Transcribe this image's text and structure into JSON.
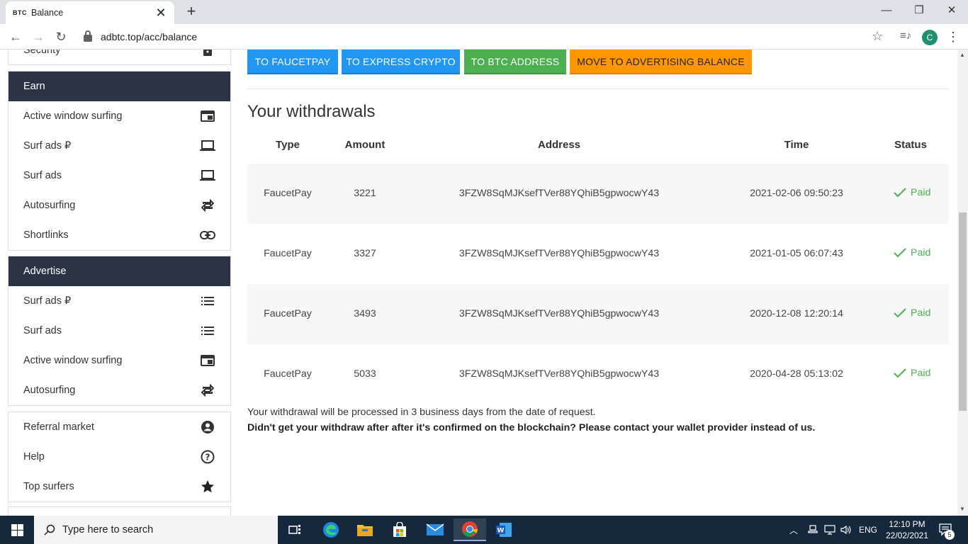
{
  "browser": {
    "tab_favicon": "BTC",
    "tab_title": "Balance",
    "url": "adbtc.top/acc/balance",
    "profile_initial": "C"
  },
  "sidebar": {
    "top_item": "Security",
    "earn": {
      "header": "Earn",
      "items": [
        {
          "label": "Active window surfing",
          "icon": "window-icon"
        },
        {
          "label": "Surf ads ₽",
          "icon": "laptop-icon"
        },
        {
          "label": "Surf ads",
          "icon": "laptop-icon"
        },
        {
          "label": "Autosurfing",
          "icon": "repeat-icon"
        },
        {
          "label": "Shortlinks",
          "icon": "link-icon"
        }
      ]
    },
    "advertise": {
      "header": "Advertise",
      "items": [
        {
          "label": "Surf ads ₽",
          "icon": "list-icon"
        },
        {
          "label": "Surf ads",
          "icon": "list-icon"
        },
        {
          "label": "Active window surfing",
          "icon": "window-icon"
        },
        {
          "label": "Autosurfing",
          "icon": "repeat-icon"
        }
      ]
    },
    "misc": {
      "items": [
        {
          "label": "Referral market",
          "icon": "account-circle-icon"
        },
        {
          "label": "Help",
          "icon": "help-circle-icon"
        },
        {
          "label": "Top surfers",
          "icon": "star-icon"
        }
      ]
    }
  },
  "actions": {
    "faucetpay": "TO FAUCETPAY",
    "express_crypto": "TO EXPRESS CRYPTO",
    "btc_address": "TO BTC ADDRESS",
    "advertising": "MOVE TO ADVERTISING BALANCE",
    "colors": {
      "blue": "#2196f3",
      "green": "#4caf50",
      "orange": "#ff9800"
    }
  },
  "withdrawals": {
    "title": "Your withdrawals",
    "columns": [
      "Type",
      "Amount",
      "Address",
      "Time",
      "Status"
    ],
    "rows": [
      {
        "type": "FaucetPay",
        "amount": "3221",
        "address": "3FZW8SqMJKsefTVer88YQhiB5gpwocwY43",
        "time": "2021-02-06 09:50:23",
        "status": "Paid"
      },
      {
        "type": "FaucetPay",
        "amount": "3327",
        "address": "3FZW8SqMJKsefTVer88YQhiB5gpwocwY43",
        "time": "2021-01-05 06:07:43",
        "status": "Paid"
      },
      {
        "type": "FaucetPay",
        "amount": "3493",
        "address": "3FZW8SqMJKsefTVer88YQhiB5gpwocwY43",
        "time": "2020-12-08 12:20:14",
        "status": "Paid"
      },
      {
        "type": "FaucetPay",
        "amount": "5033",
        "address": "3FZW8SqMJKsefTVer88YQhiB5gpwocwY43",
        "time": "2020-04-28 05:13:02",
        "status": "Paid"
      }
    ],
    "note": "Your withdrawal will be processed in 3 business days from the date of request.",
    "note_bold": "Didn't get your withdraw after after it's confirmed on the blockchain? Please contact your wallet provider instead of us."
  },
  "taskbar": {
    "search_placeholder": "Type here to search",
    "language": "ENG",
    "time": "12:10 PM",
    "date": "22/02/2021",
    "notification_count": "5"
  }
}
